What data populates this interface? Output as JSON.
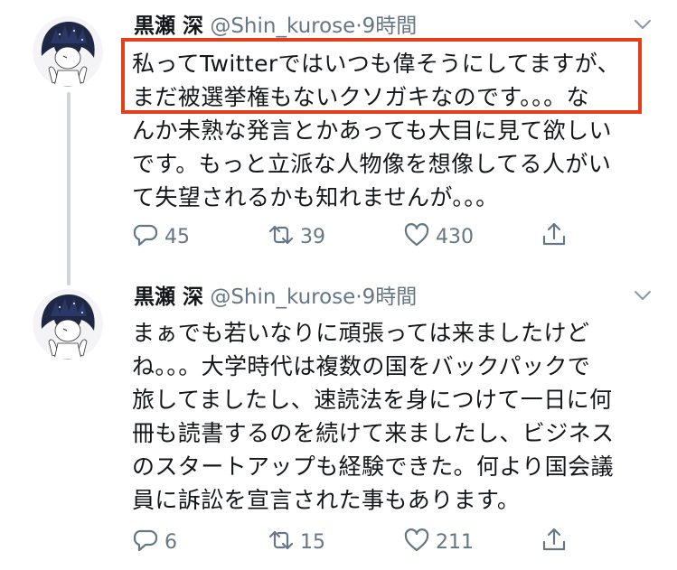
{
  "colors": {
    "highlight": "#e2401d",
    "muted": "#657786",
    "divider": "#ccd6dd"
  },
  "tweets": [
    {
      "name": "黒瀬 深",
      "handle": "@Shin_kurose",
      "dot": "·",
      "time": "9時間",
      "lines": [
        "私ってTwitterではいつも偉そうにしてますが、",
        "まだ被選挙権もないクソガキなのです。。。な",
        "んか未熟な発言とかあっても大目に見て欲しい",
        "です。もっと立派な人物像を想像してる人がい",
        "て失望されるかも知れませんが。。。"
      ],
      "reply_count": "45",
      "retweet_count": "39",
      "like_count": "430"
    },
    {
      "name": "黒瀬 深",
      "handle": "@Shin_kurose",
      "dot": "·",
      "time": "9時間",
      "lines": [
        "まぁでも若いなりに頑張っては来ましたけど",
        "ね。。。大学時代は複数の国をバックパックで",
        "旅してましたし、速読法を身につけて一日に何",
        "冊も読書するのを続けて来ましたし、ビジネス",
        "のスタートアップも経験できた。何より国会議",
        "員に訴訟を宣言された事もあります。"
      ],
      "reply_count": "6",
      "retweet_count": "15",
      "like_count": "211"
    }
  ],
  "icons": {
    "reply": "reply-icon",
    "retweet": "retweet-icon",
    "like": "like-icon",
    "share": "share-icon",
    "more": "chevron-down-icon"
  }
}
